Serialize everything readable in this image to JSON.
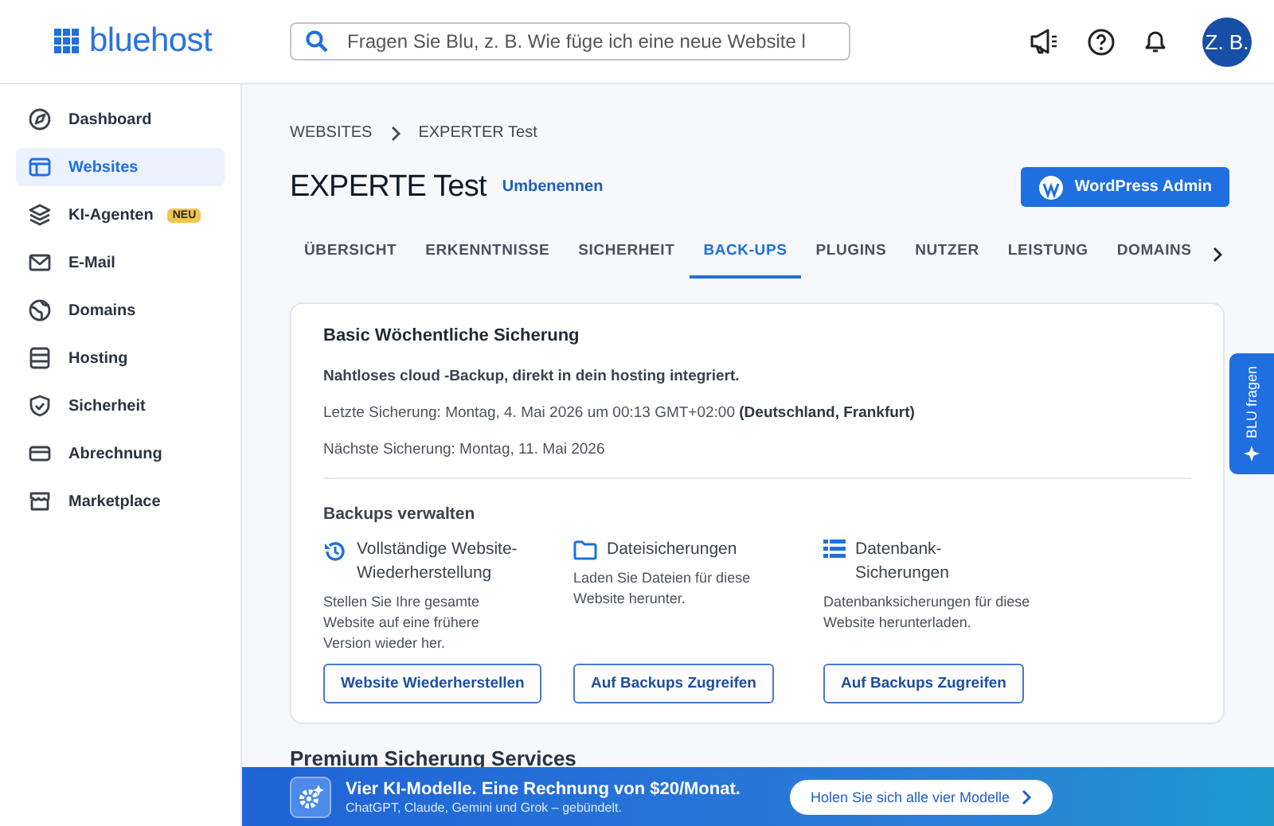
{
  "header": {
    "logo": "bluehost",
    "search": {
      "placeholder": "Fragen Sie Blu, z. B. Wie füge ich eine neue Website l"
    },
    "avatar": "Z. B."
  },
  "sidebar": {
    "items": [
      {
        "label": "Dashboard",
        "selected": false
      },
      {
        "label": "Websites",
        "selected": true
      },
      {
        "label": "KI-Agenten",
        "selected": false,
        "badge": "NEU"
      },
      {
        "label": "E-Mail",
        "selected": false
      },
      {
        "label": "Domains",
        "selected": false
      },
      {
        "label": "Hosting",
        "selected": false
      },
      {
        "label": "Sicherheit",
        "selected": false
      },
      {
        "label": "Abrechnung",
        "selected": false
      },
      {
        "label": "Marketplace",
        "selected": false
      }
    ]
  },
  "breadcrumb": [
    "WEBSITES",
    "EXPERTER Test"
  ],
  "title": "EXPERTE Test",
  "rename_link": "Umbenennen",
  "wp_button": "WordPress Admin",
  "tabs": [
    {
      "label": "ÜBERSICHT",
      "selected": false
    },
    {
      "label": "ERKENNTNISSE",
      "selected": false
    },
    {
      "label": "SICHERHEIT",
      "selected": false
    },
    {
      "label": "BACK-UPS",
      "selected": true
    },
    {
      "label": "PLUGINS",
      "selected": false
    },
    {
      "label": "NUTZER",
      "selected": false
    },
    {
      "label": "LEISTUNG",
      "selected": false
    },
    {
      "label": "DOMAINS",
      "selected": false
    }
  ],
  "backup_card": {
    "title": "Basic Wöchentliche Sicherung",
    "intro": "Nahtloses cloud -Backup, direkt in dein hosting integriert.",
    "last_backup": "Letzte Sicherung:  Montag, 4. Mai 2026 um 00:13 GMT+02:00 **(Deutschland, Frankfurt)**",
    "next_backup": "Nächste Sicherung:  Montag, 11. Mai 2026",
    "manage_title": "Backups verwalten",
    "options": [
      {
        "title": "Vollständige Website-Wiederherstellung",
        "description": "Stellen Sie Ihre gesamte Website auf eine frühere Version wieder her.",
        "button": "Website Wiederherstellen"
      },
      {
        "title": "Dateisicherungen",
        "description": "Laden Sie Dateien für diese Website herunter.",
        "button": "Auf Backups Zugreifen"
      },
      {
        "title": "Datenbank-Sicherungen",
        "description": "Datenbanksicherungen für diese Website herunterladen.",
        "button": "Auf Backups Zugreifen"
      }
    ]
  },
  "premium_heading": "Premium Sicherung Services",
  "banner": {
    "title": "Vier KI-Modelle. Eine Rechnung von $20/Monat.",
    "subtitle": "ChatGPT, Claude, Gemini und Grok – gebündelt.",
    "button": "Holen Sie sich alle vier Modelle"
  },
  "blu_tab": "BLU fragen"
}
